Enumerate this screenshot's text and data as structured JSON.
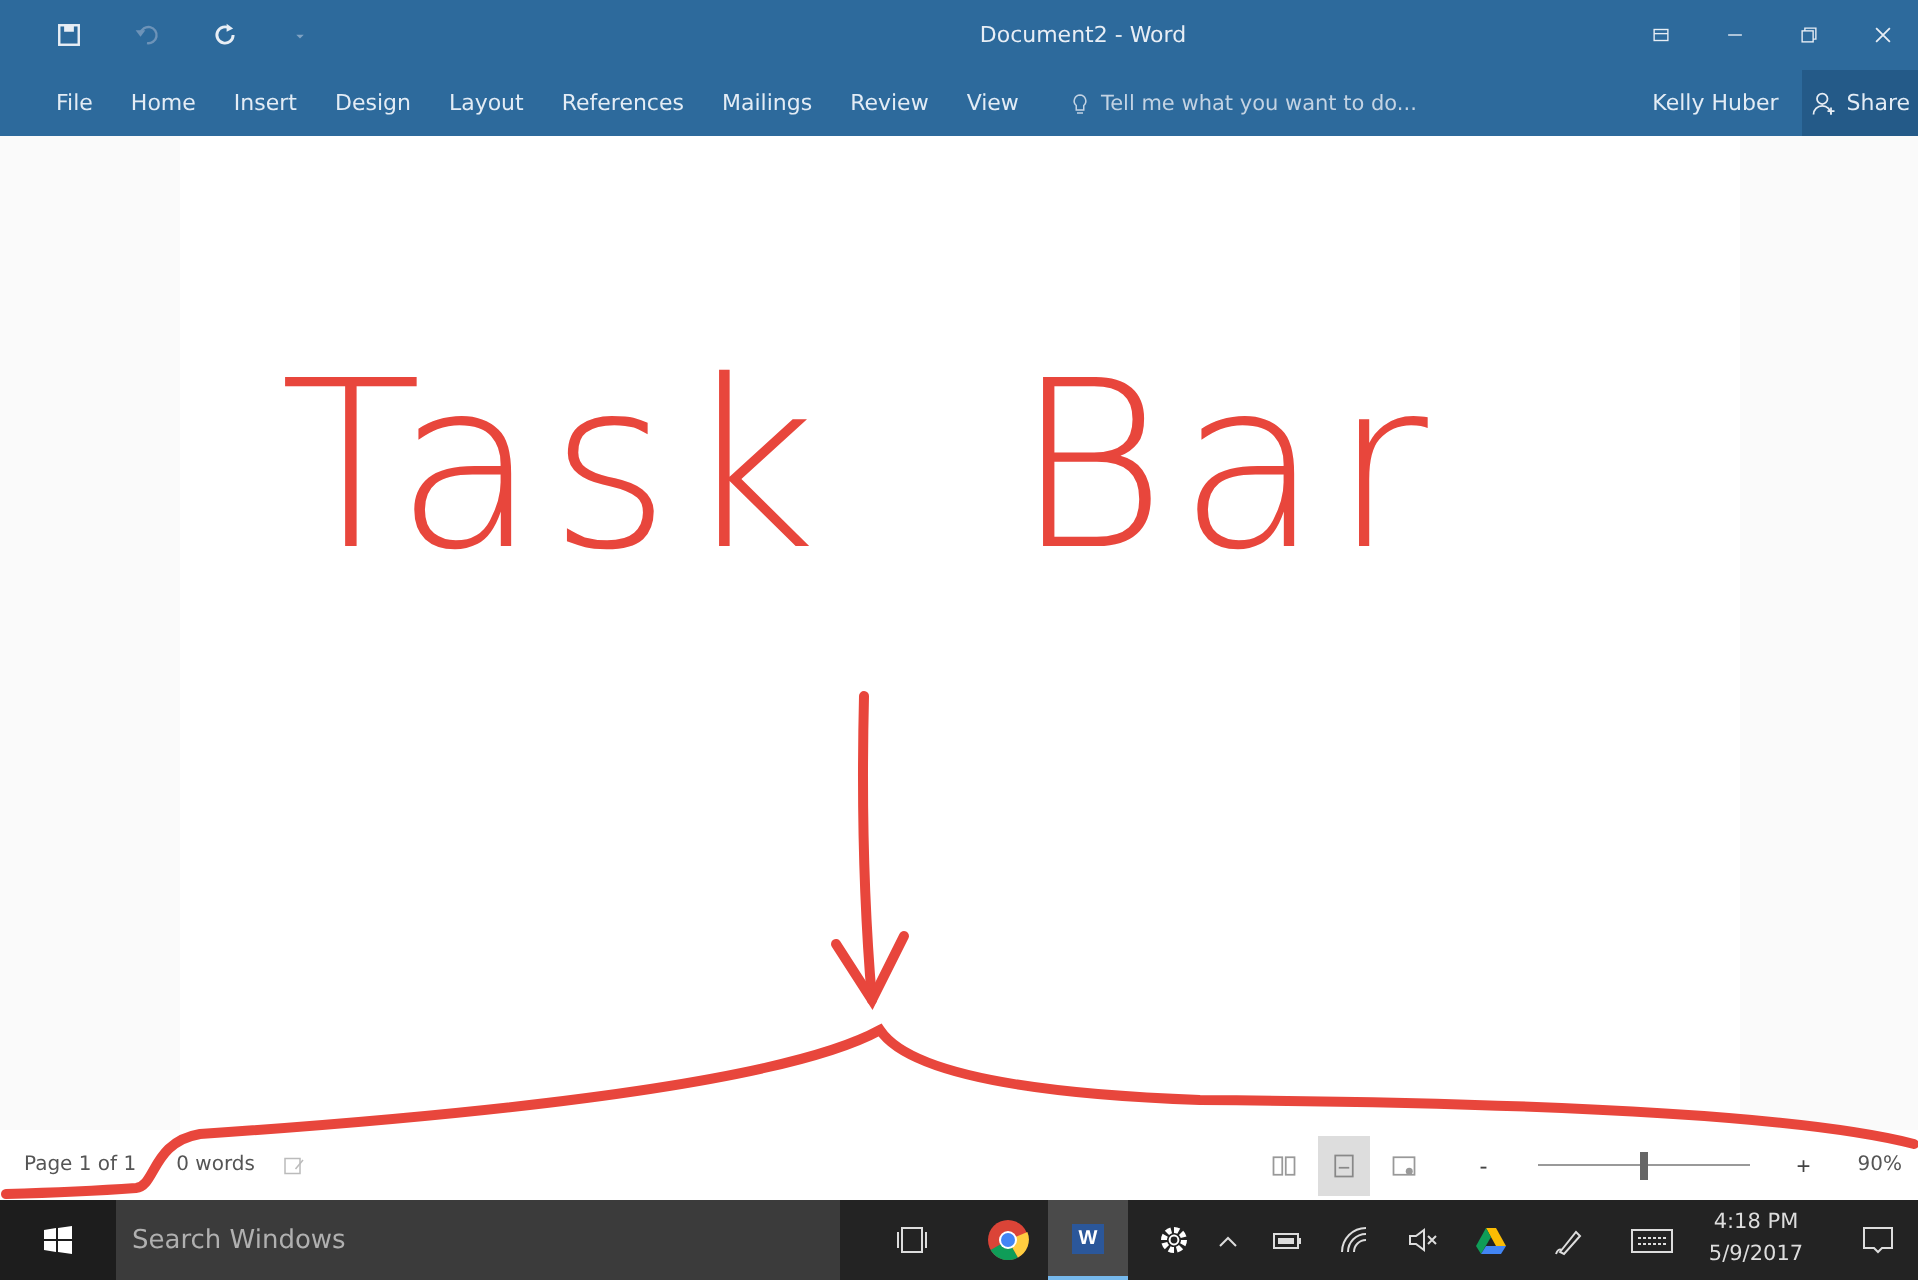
{
  "title_bar": {
    "title": "Document2 - Word"
  },
  "ribbon": {
    "tabs": [
      {
        "label": "File",
        "selected": false
      },
      {
        "label": "Home",
        "selected": false
      },
      {
        "label": "Insert",
        "selected": false
      },
      {
        "label": "Design",
        "selected": false
      },
      {
        "label": "Layout",
        "selected": false
      },
      {
        "label": "References",
        "selected": false
      },
      {
        "label": "Mailings",
        "selected": false
      },
      {
        "label": "Review",
        "selected": false
      },
      {
        "label": "View",
        "selected": false
      }
    ],
    "tell_me": {
      "placeholder": "Tell me what you want to do..."
    },
    "user": "Kelly Huber",
    "share": "Share"
  },
  "annotation": {
    "text": "Task Bar"
  },
  "status_bar": {
    "page": "Page 1 of 1",
    "words": "0 words",
    "views": [
      {
        "kind": "read",
        "selected": false
      },
      {
        "kind": "print",
        "selected": true
      },
      {
        "kind": "web",
        "selected": false
      }
    ],
    "zoom": {
      "minus": "-",
      "plus": "+",
      "level": 0.5,
      "reading": "90%"
    }
  },
  "taskbar": {
    "search": {
      "placeholder": "Search Windows"
    },
    "apps": [
      {
        "kind": "browser",
        "selected": false
      },
      {
        "kind": "word",
        "label": "W",
        "selected": true
      }
    ],
    "clock": {
      "time": "4:18 PM",
      "date": "5/9/2017"
    }
  }
}
